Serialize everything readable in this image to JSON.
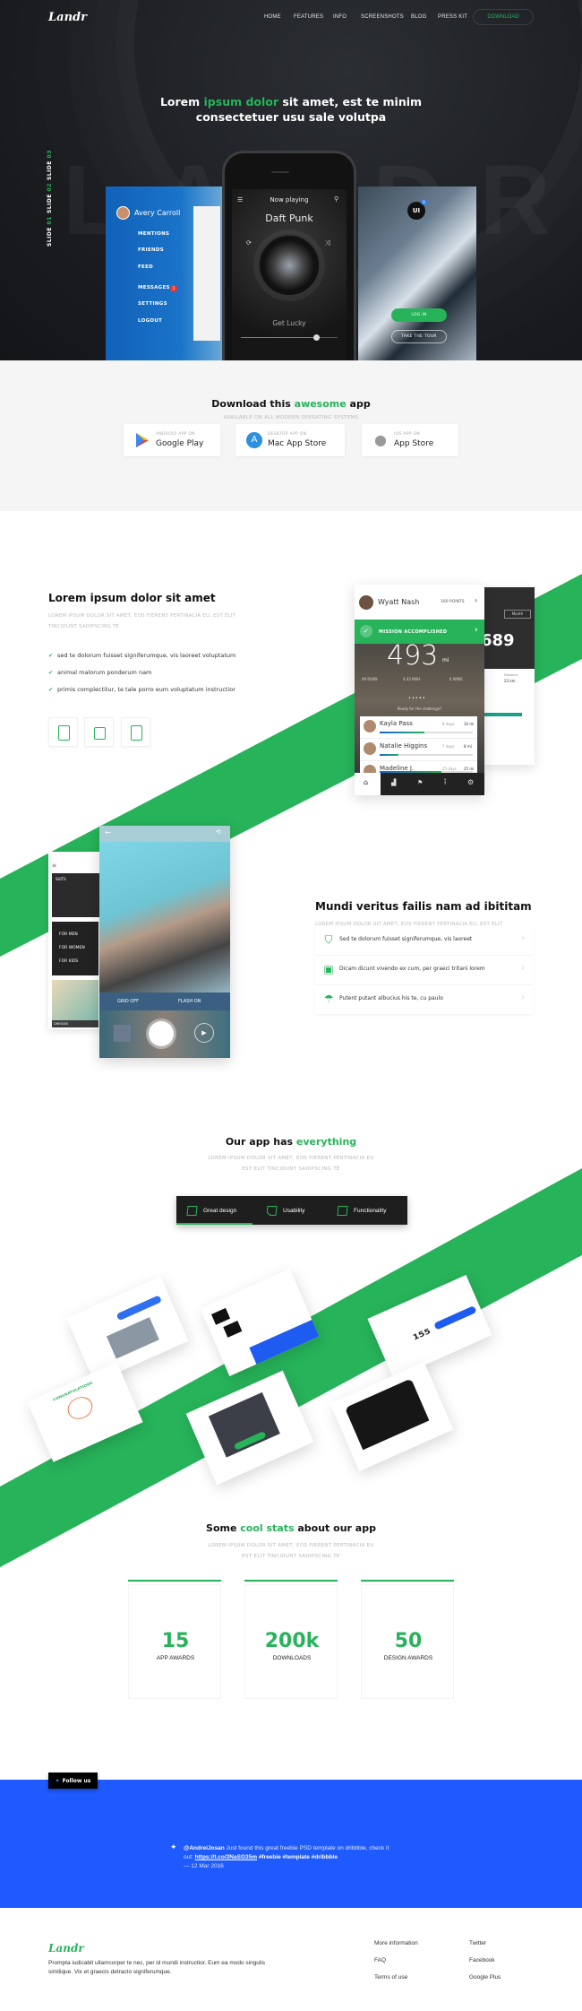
{
  "colors": {
    "accent": "#27b35a",
    "hero_bg": "#1c1e22",
    "twitter_bg": "#1f5aff"
  },
  "nav": {
    "logo": "Landr",
    "links": [
      "HOME",
      "FEATURES",
      "INFO",
      "SCREENSHOTS",
      "BLOG",
      "PRESS KIT"
    ],
    "download": "DOWNLOAD"
  },
  "hero": {
    "title_pre": "Lorem ",
    "title_accent": "ipsum dolor",
    "title_post": " sit amet, est te minim",
    "title_line2": "consectetuer usu sale volutpa",
    "background_word": "LANDR",
    "slides": [
      {
        "label": "SLIDE ",
        "num": "01"
      },
      {
        "label": "SLIDE ",
        "num": "02"
      },
      {
        "label": "SLIDE ",
        "num": "03"
      }
    ],
    "menu": {
      "user": "Avery Carroll",
      "items": [
        "MENTIONS",
        "FRIENDS",
        "FEED",
        "MESSAGES",
        "SETTINGS",
        "LOGOUT"
      ],
      "messages_badge": "1"
    },
    "player": {
      "header": "Now playing",
      "artist": "Daft Punk",
      "song": "Get Lucky",
      "progress": 0.78
    },
    "login": {
      "logo": "UI",
      "logo_badge": "8",
      "login_btn": "LOG IN",
      "tour_btn": "TAKE THE TOUR"
    }
  },
  "download": {
    "title_pre": "Download this ",
    "title_accent": "awesome",
    "title_post": " app",
    "subtitle": "AVAILABLE ON ALL MODERN OPERATING SYSTEMS",
    "stores": [
      {
        "icon": "google-play-icon",
        "small": "ANDROID APP ON",
        "big": "Google Play"
      },
      {
        "icon": "mac-app-store-icon",
        "small": "DESKTOP APP ON",
        "big": "Mac App Store"
      },
      {
        "icon": "apple-icon",
        "small": "IOS APP ON",
        "big": "App Store"
      }
    ]
  },
  "feature1": {
    "title": "Lorem ipsum dolor sit amet",
    "subtitle": "LOREM IPSUM DOLOR SIT AMET, EOS FIERENT PERTINACIA EU, EST ELIT TINCIDUNT SADIPSCING TE",
    "checks": [
      "sed te dolorum fuisset signiferumque, vis laoreet voluptatum",
      "animal malorum ponderum nam",
      "primis complectitur, te tale porro eum voluptatum instructior"
    ],
    "devices": [
      "phone-icon",
      "watch-icon",
      "ipod-icon"
    ],
    "fitness_app": {
      "user": "Wyatt Nash",
      "points": "160 POINTS",
      "mission": "MISSION ACCOMPLISHED",
      "distance": "493",
      "unit": "mi",
      "stats": [
        "49 RUNS",
        "4.43 MI/H",
        "6 WINS"
      ],
      "challenge": "Ready for the challenge?",
      "friends": [
        {
          "name": "Kayla Pass",
          "days": "8 days",
          "miles": "10 mi",
          "progress": 0.48
        },
        {
          "name": "Natalie Higgins",
          "days": "7 days",
          "miles": "8 mi",
          "progress": 0.2
        },
        {
          "name": "Madeline J.",
          "days": "25 days",
          "miles": "25 mi",
          "progress": 0.66
        }
      ],
      "back_card": {
        "tab": "Month",
        "value": "689",
        "distance_label": "Distance",
        "distance": "23 km"
      }
    }
  },
  "feature2": {
    "title": "Mundi veritus failis nam ad ibititam",
    "subtitle": "LOREM IPSUM DOLOR SIT AMET, EOS FIERENT PERTINACIA EU, EST ELIT TINCIDUNT SADIPSCING TE",
    "items": [
      {
        "icon": "shield-icon",
        "text": "Sed te dolorum fuisset signiferumque, vis laoreet"
      },
      {
        "icon": "package-icon",
        "text": "Dicam dicunt vivendo ex cum, per graeci tritani lorem"
      },
      {
        "icon": "umbrella-icon",
        "text": "Putent putant albucius his te, cu paulo"
      }
    ],
    "camera_app": {
      "grid": "GRID OFF",
      "flash": "FLASH ON"
    },
    "shop_app": {
      "categories": [
        "FOR MEN",
        "FOR WOMEN",
        "FOR KIDS"
      ],
      "suits": "SUITS",
      "dresses": "DRESSES"
    }
  },
  "everything": {
    "title_pre": "Our app has ",
    "title_accent": "everything",
    "subtitle_line1": "LOREM IPSUM DOLOR SIT AMET, EOS FIERENT PERTINACIA EU",
    "subtitle_line2": "EST ELIT TINCIDUNT SADIPSCING TE",
    "tabs": [
      {
        "icon": "great-design-icon",
        "label": "Great design",
        "active": true
      },
      {
        "icon": "usability-icon",
        "label": "Usability",
        "active": false
      },
      {
        "icon": "functionality-icon",
        "label": "Functionality",
        "active": false
      }
    ],
    "screenshot_texts": {
      "checkout_value": "155",
      "congrats": "CONGRATULATIONS"
    }
  },
  "stats": {
    "title_pre": "Some ",
    "title_accent": "cool stats",
    "title_post": " about our app",
    "subtitle_line1": "LOREM IPSUM DOLOR SIT AMET, EOS FIERENT PERTINACIA EU",
    "subtitle_line2": "EST ELIT TINCIDUNT SADIPSCING TE",
    "items": [
      {
        "value": "15",
        "label": "APP AWARDS"
      },
      {
        "value": "200k",
        "label": "DOWNLOADS"
      },
      {
        "value": "50",
        "label": "DESIGN AWARDS"
      }
    ]
  },
  "twitter": {
    "follow": "Follow us",
    "handle": "@AndreiJosan",
    "text1": " Just found this great freebie PSD template on dribbble, check it out: ",
    "link": "https://t.co/3NaSG35m",
    "tags": " #freebie #template #dribbble",
    "date": "— 12 Mar 2016"
  },
  "footer": {
    "logo": "Landr",
    "text": "Prompta iudicabit ullamcorper te nec, per id mundi instructior. Eum ea modo singulis similique. Vix et graecis detracto signiferumque.",
    "col1": [
      "More information",
      "FAQ",
      "Terms of use"
    ],
    "col2": [
      "Twitter",
      "Facebook",
      "Google Plus"
    ]
  }
}
